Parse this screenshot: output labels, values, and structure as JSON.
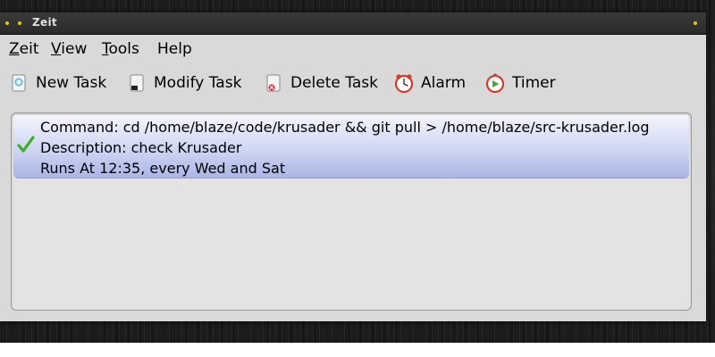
{
  "window": {
    "title": "Zeit"
  },
  "menu": {
    "items": [
      {
        "accel": "Z",
        "rest": "eit"
      },
      {
        "accel": "V",
        "rest": "iew"
      },
      {
        "accel": "T",
        "rest": "ools"
      },
      {
        "accel": "",
        "rest": "Help"
      }
    ]
  },
  "toolbar": {
    "new_task": {
      "label": "New Task",
      "icon": "new-task-icon"
    },
    "modify_task": {
      "label": "Modify Task",
      "icon": "modify-task-icon"
    },
    "delete_task": {
      "label": "Delete Task",
      "icon": "delete-task-icon"
    },
    "alarm": {
      "label": "Alarm",
      "icon": "alarm-clock-icon"
    },
    "timer": {
      "label": "Timer",
      "icon": "timer-clock-icon"
    }
  },
  "tasks": [
    {
      "enabled": true,
      "command": "Command: cd /home/blaze/code/krusader && git pull > /home/blaze/src-krusader.log",
      "description": "Description: check Krusader",
      "schedule": "Runs At 12:35, every Wed and Sat"
    }
  ],
  "colors": {
    "accent_yellow": "#f5c400",
    "check_green": "#3cb02a",
    "selection_blue": "#aab6e6"
  }
}
